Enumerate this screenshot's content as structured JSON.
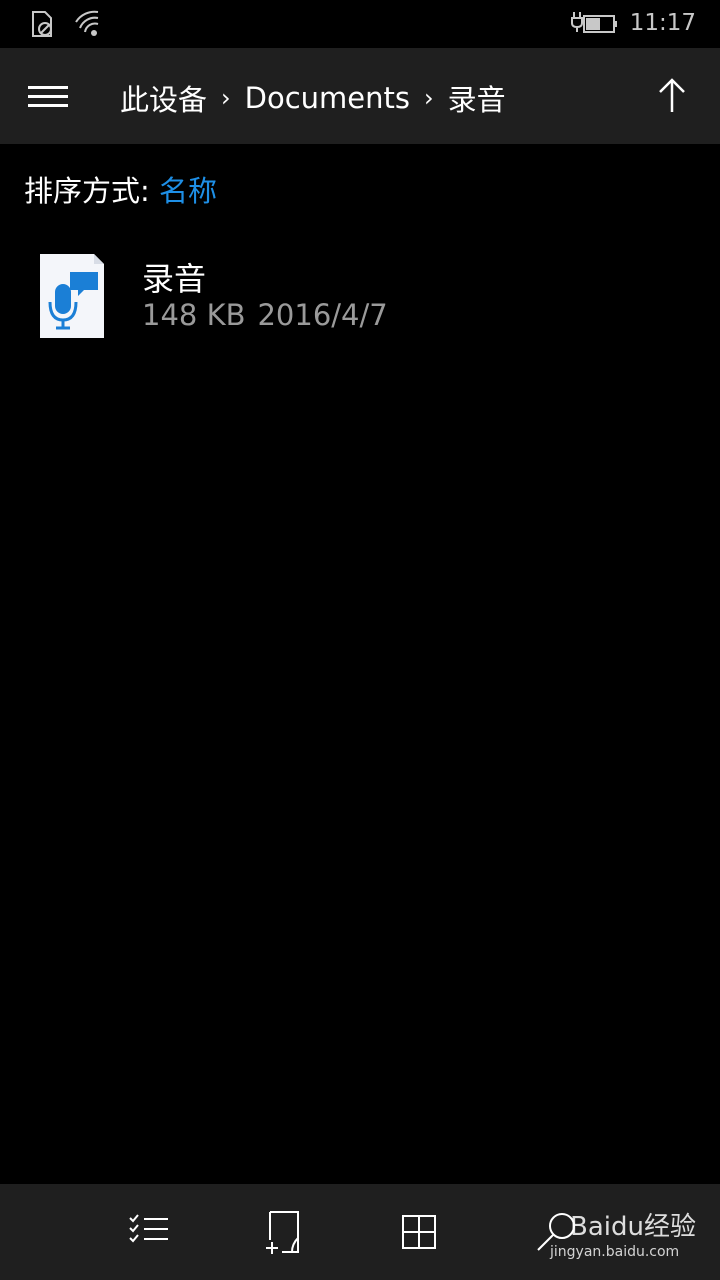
{
  "status_bar": {
    "time": "11:17",
    "icons": [
      "no-sim-icon",
      "wifi-icon",
      "battery-charging-icon"
    ]
  },
  "header": {
    "menu_icon": "hamburger-icon",
    "breadcrumb": [
      "此设备",
      "Documents",
      "录音"
    ],
    "separator": "›",
    "up_icon": "arrow-up-icon"
  },
  "sort": {
    "label": "排序方式: ",
    "value": "名称"
  },
  "files": [
    {
      "name": "录音",
      "size": "148 KB",
      "date": "2016/4/7",
      "icon": "voice-recording-file-icon"
    }
  ],
  "app_bar": {
    "buttons": [
      "select-icon",
      "new-folder-icon",
      "view-tiles-icon",
      "search-icon"
    ]
  },
  "watermark": {
    "logo": "Baidu经验",
    "url": "jingyan.baidu.com"
  },
  "colors": {
    "accent": "#1e8fe6",
    "header_bg": "#1f1f1f",
    "background": "#000000",
    "meta_text": "#9a9a9a"
  }
}
